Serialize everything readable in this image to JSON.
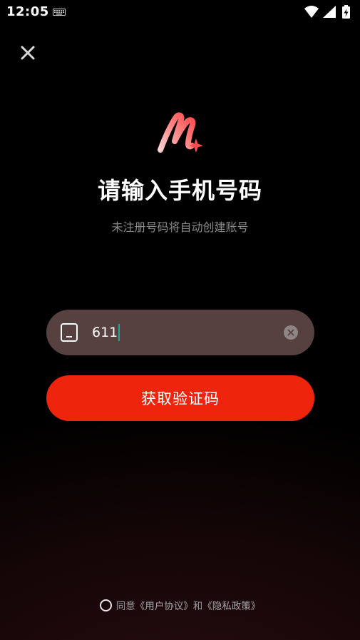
{
  "status_bar": {
    "time": "12:05",
    "icons": [
      "keyboard-icon",
      "wifi-icon",
      "signal-icon",
      "battery-charging-icon"
    ]
  },
  "header": {
    "close_icon": "close-icon"
  },
  "brand": {
    "logo_icon": "app-logo-icon"
  },
  "main": {
    "title": "请输入手机号码",
    "subtitle": "未注册号码将自动创建账号"
  },
  "phone_field": {
    "icon": "phone-icon",
    "value": "611",
    "clear_icon": "clear-circle-icon"
  },
  "get_code_button": {
    "label": "获取验证码"
  },
  "agreement": {
    "prefix": "同意",
    "user_agreement": "《用户协议》",
    "conjunction": "和",
    "privacy_policy": "《隐私政策》"
  },
  "colors": {
    "accent_button": "#ee240c",
    "input_background": "#574040",
    "caret": "#1fa89a",
    "subtitle_text": "#8a8a8a"
  }
}
